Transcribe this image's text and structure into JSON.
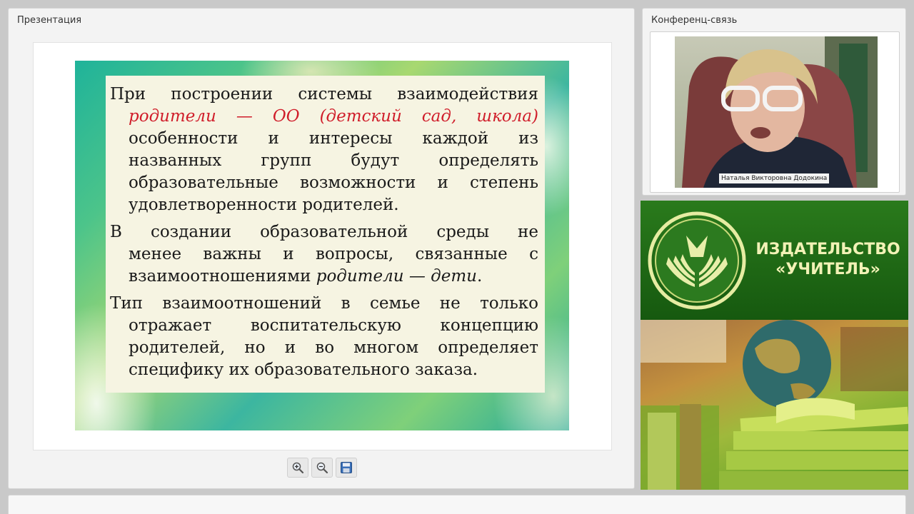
{
  "presentation": {
    "title": "Презентация",
    "slide": {
      "paragraphs": [
        {
          "lines": [
            {
              "text": "При построении системы взаимодействия"
            },
            {
              "text": "родители — ОО (детский сад, школа)",
              "style": "red-italic",
              "indent": true
            },
            {
              "text": "особенности и интересы каждой из",
              "indent": true
            },
            {
              "text": "названных групп будут определять",
              "indent": true
            },
            {
              "text": "образовательные возможности и степень",
              "indent": true
            },
            {
              "text": "удовлетворенности родителей.",
              "indent": true,
              "last": true
            }
          ]
        },
        {
          "lines": [
            {
              "text": "В создании образовательной среды не"
            },
            {
              "text": "менее важны и вопросы, связанные с",
              "indent": true
            },
            {
              "text_parts": [
                "взаимоотношениями ",
                "родители — дети",
                "."
              ],
              "indent": true,
              "last": true
            }
          ]
        },
        {
          "lines": [
            {
              "text": "Тип взаимоотношений в семье не только"
            },
            {
              "text": "отражает воспитательскую концепцию",
              "indent": true
            },
            {
              "text": "родителей, но и во многом определяет",
              "indent": true
            },
            {
              "text": "специфику их образовательного заказа.",
              "indent": true,
              "last": true
            }
          ]
        }
      ]
    },
    "toolbar": {
      "zoom_in_icon": "zoom-in-icon",
      "zoom_out_icon": "zoom-out-icon",
      "save_icon": "save-icon"
    }
  },
  "conference": {
    "title": "Конференц-связь",
    "speaker_name": "Наталья Викторовна Додокина"
  },
  "publisher": {
    "name_line1": "ИЗДАТЕЛЬСТВО",
    "name_line2": "«УЧИТЕЛЬ»",
    "logo_icon": "book-logo-icon"
  },
  "colors": {
    "banner_green": "#1f6a15",
    "banner_text": "#f2f2b6",
    "slide_red": "#d01d2a"
  }
}
